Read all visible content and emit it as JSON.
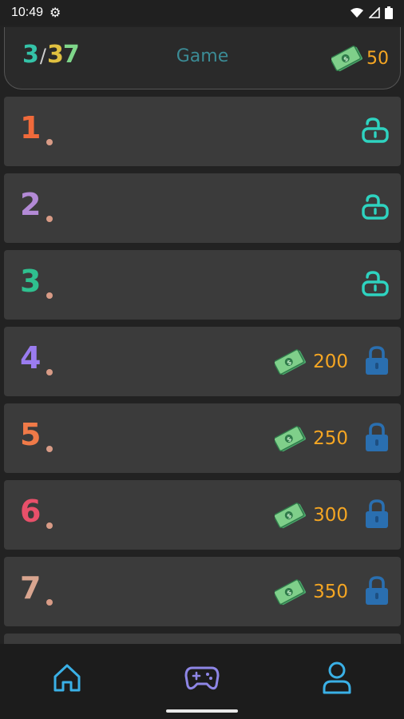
{
  "status_bar": {
    "time": "10:49",
    "icons": [
      "gear-icon",
      "wifi-icon",
      "signal-icon",
      "battery-icon"
    ]
  },
  "header": {
    "progress_current": "3",
    "progress_separator": "/",
    "progress_total_d1": "3",
    "progress_total_d2": "7",
    "title": "Game",
    "coins": "50",
    "coin_icon": "cash-icon"
  },
  "levels": [
    {
      "number": "1",
      "color": "#f06a3b",
      "locked": false,
      "price": ""
    },
    {
      "number": "2",
      "color": "#b38ad6",
      "locked": false,
      "price": ""
    },
    {
      "number": "3",
      "color": "#2fc08f",
      "locked": false,
      "price": ""
    },
    {
      "number": "4",
      "color": "#9a7cf0",
      "locked": true,
      "price": "200"
    },
    {
      "number": "5",
      "color": "#f07a48",
      "locked": true,
      "price": "250"
    },
    {
      "number": "6",
      "color": "#e8506a",
      "locked": true,
      "price": "300"
    },
    {
      "number": "7",
      "color": "#d9a58f",
      "locked": true,
      "price": "350"
    }
  ],
  "colors": {
    "unlocked_icon": "#2ed3c0",
    "locked_icon": "#2a6fb0",
    "price": "#f5a623",
    "title": "#3b8b95",
    "nav_home": "#3ab0e6",
    "nav_game": "#8e86e6",
    "nav_profile": "#3ab0e6"
  },
  "bottom_nav": {
    "items": [
      "home-icon",
      "gamepad-icon",
      "profile-icon"
    ]
  }
}
